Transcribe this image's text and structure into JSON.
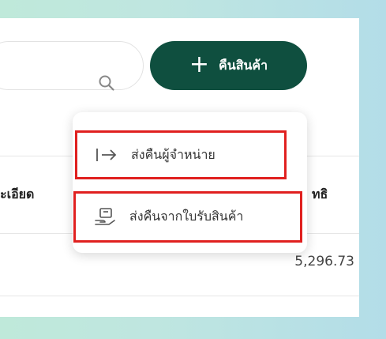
{
  "toolbar": {
    "search_placeholder": "",
    "add_button_icon": "+",
    "add_button_label": "คืนสินค้า"
  },
  "menu": {
    "items": [
      {
        "label": "ส่งคืนผู้จำหน่าย",
        "icon": "arrow-right-to-bar-icon"
      },
      {
        "label": "ส่งคืนจากใบรับสินค้า",
        "icon": "hand-box-icon"
      }
    ]
  },
  "table": {
    "header_left": "ะเอียด",
    "header_right": "ทธิ",
    "rows": [
      {
        "amount": "5,296.73"
      }
    ]
  },
  "colors": {
    "primary": "#0f4f3f",
    "highlight_border": "#e0201f",
    "background_left": "#bfe9da",
    "background_right": "#b3dde8"
  }
}
